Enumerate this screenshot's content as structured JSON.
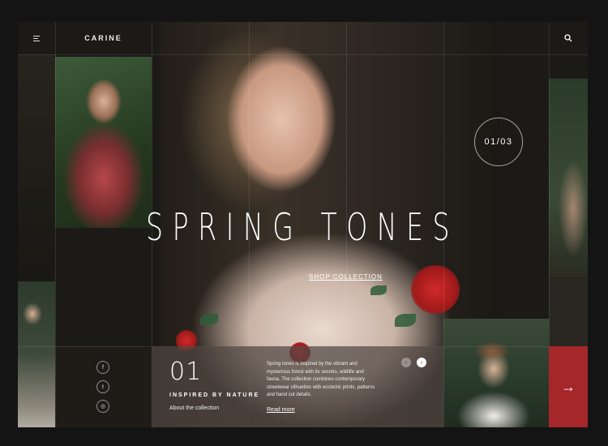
{
  "header": {
    "logo": "CARINE",
    "menu_icon": "menu-icon",
    "search_icon": "search-icon"
  },
  "hero": {
    "slide_counter": "01/03",
    "title": "SPRING TONES",
    "cta": "SHOP COLLECTION"
  },
  "social": [
    {
      "icon": "facebook-icon",
      "glyph": "f"
    },
    {
      "icon": "twitter-icon",
      "glyph": "t"
    },
    {
      "icon": "instagram-icon",
      "glyph": "◎"
    }
  ],
  "panel": {
    "number": "01",
    "subtitle": "INSPIRED BY NATURE",
    "about": "About the collection",
    "description": "Spring tones is inspired by the vibrant and mysterious forest with its secrets, wildlife and fauna. The collection combines contemporary streetwear silhuettes with ecclectic prints, patterns and hand cut details.",
    "read_more": "Read more",
    "prev_glyph": "‹",
    "next_glyph": "›"
  },
  "next_arrow": "→",
  "colors": {
    "accent": "#a5272a",
    "background": "#1b1a17"
  }
}
